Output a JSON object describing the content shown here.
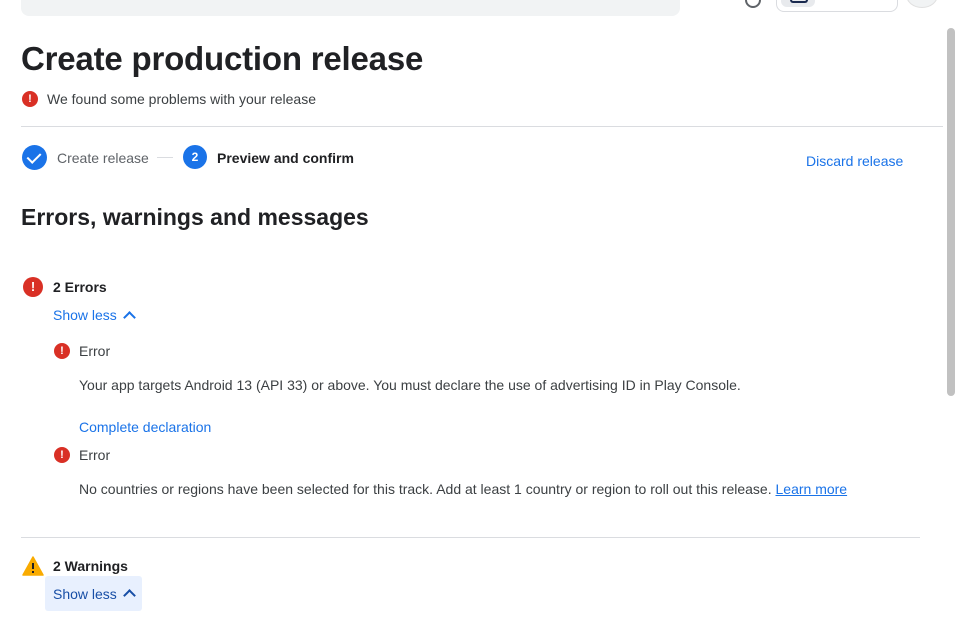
{
  "page": {
    "title": "Create production release",
    "problem_banner": "We found some problems with your release"
  },
  "stepper": {
    "steps": [
      {
        "label": "Create release",
        "state": "done"
      },
      {
        "label": "Preview and confirm",
        "number": "2",
        "state": "active"
      }
    ],
    "discard_label": "Discard release"
  },
  "section": {
    "title": "Errors, warnings and messages"
  },
  "errors": {
    "count_label": "2 Errors",
    "toggle_label": "Show less",
    "items": [
      {
        "label": "Error",
        "message": "Your app targets Android 13 (API 33) or above. You must declare the use of advertising ID in Play Console.",
        "action_label": "Complete declaration"
      },
      {
        "label": "Error",
        "message": "No countries or regions have been selected for this track. Add at least 1 country or region to roll out this release.",
        "link_label": "Learn more"
      }
    ]
  },
  "warnings": {
    "count_label": "2 Warnings",
    "toggle_label": "Show less"
  },
  "colors": {
    "accent": "#1a73e8",
    "error": "#d93025",
    "warning": "#f9ab00"
  },
  "icons": {
    "error": "error-icon",
    "warning": "warning-icon",
    "check": "check-icon",
    "chevron": "chevron-up-icon"
  }
}
